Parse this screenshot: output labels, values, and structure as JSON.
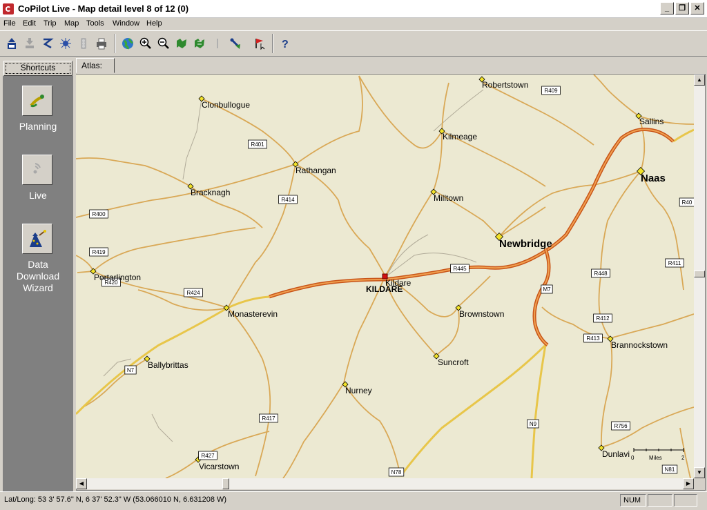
{
  "window": {
    "title": "CoPilot Live - Map detail level 8 of 12 (0)"
  },
  "menu": [
    "File",
    "Edit",
    "Trip",
    "Map",
    "Tools",
    "Window",
    "Help"
  ],
  "toolbar": {
    "buttons": [
      "save-trip-icon",
      "download-icon",
      "route-icon",
      "gps-icon",
      "traffic-icon",
      "print-icon",
      "globe-icon",
      "zoom-in-icon",
      "zoom-out-icon",
      "map-view-icon",
      "map-3d-icon",
      "disabled-icon",
      "street-sign-icon",
      "flag-cursor-icon",
      "help-icon"
    ]
  },
  "sidebar": {
    "header": "Shortcuts",
    "items": [
      {
        "label": "Planning",
        "icon": "planning-icon"
      },
      {
        "label": "Live",
        "icon": "live-icon"
      },
      {
        "label": "Data Download Wizard",
        "lines": [
          "Data",
          "Download",
          "Wizard"
        ],
        "icon": "wizard-icon"
      }
    ]
  },
  "map": {
    "tab": "Atlas:",
    "towns": [
      {
        "name": "Robertstown"
      },
      {
        "name": "Clonbullogue"
      },
      {
        "name": "Sallins"
      },
      {
        "name": "Kilmeage"
      },
      {
        "name": "Rathangan"
      },
      {
        "name": "Naas"
      },
      {
        "name": "Bracknagh"
      },
      {
        "name": "Milltown"
      },
      {
        "name": "Newbridge"
      },
      {
        "name": "Portarlington"
      },
      {
        "name": "Kildare"
      },
      {
        "name": "KILDARE"
      },
      {
        "name": "Monasterevin"
      },
      {
        "name": "Brownstown"
      },
      {
        "name": "Brannockstown"
      },
      {
        "name": "Ballybrittas"
      },
      {
        "name": "Suncroft"
      },
      {
        "name": "Nurney"
      },
      {
        "name": "Dunlavi"
      },
      {
        "name": "Vicarstown"
      }
    ],
    "roads": [
      "R409",
      "R401",
      "R414",
      "R400",
      "R419",
      "R420",
      "R424",
      "R445",
      "M7",
      "R448",
      "R411",
      "R412",
      "R413",
      "N7",
      "R417",
      "N9",
      "R756",
      "R427",
      "N78",
      "N81",
      "R40"
    ],
    "scale": {
      "start": "0",
      "unit": "Miles",
      "end": "2"
    }
  },
  "status": {
    "coords": "Lat/Long:  53  3' 57.6\" N,   6 37' 52.3\" W (53.066010 N, 6.631208 W)",
    "num": "NUM"
  }
}
